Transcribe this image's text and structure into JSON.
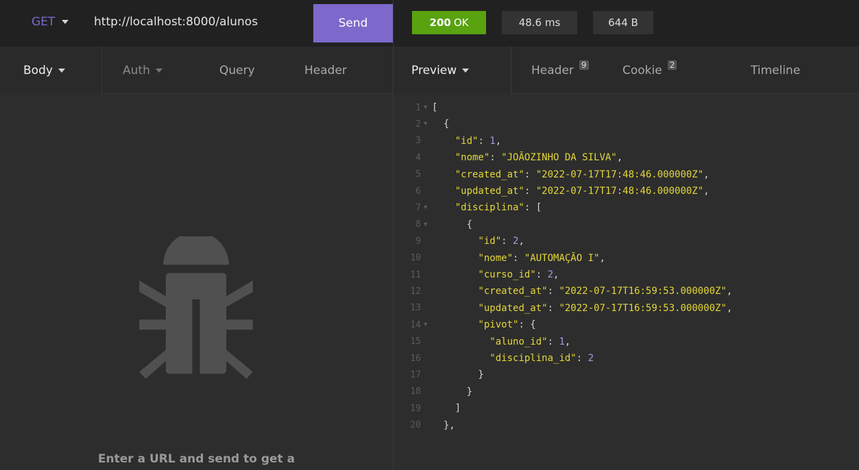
{
  "request": {
    "method": "GET",
    "url": "http://localhost:8000/alunos",
    "send_label": "Send",
    "tabs": [
      {
        "label": "Body"
      },
      {
        "label": "Auth"
      },
      {
        "label": "Query"
      },
      {
        "label": "Header"
      }
    ],
    "empty_hint": "Enter a URL and send to get a"
  },
  "response": {
    "status_code": "200",
    "status_text": "OK",
    "time": "48.6 ms",
    "size": "644 B",
    "tabs": [
      {
        "label": "Preview"
      },
      {
        "label": "Header",
        "badge": "9"
      },
      {
        "label": "Cookie",
        "badge": "2"
      },
      {
        "label": "Timeline"
      }
    ]
  },
  "code_lines": [
    {
      "n": "1",
      "fold": true,
      "html": "<span class=\"txt\">[</span>"
    },
    {
      "n": "2",
      "fold": true,
      "html": "<span class=\"txt\">  {</span>"
    },
    {
      "n": "3",
      "fold": false,
      "html": "    <span class=\"k\">\"id\"</span><span class=\"txt\">: </span><span class=\"n\">1</span><span class=\"txt\">,</span>"
    },
    {
      "n": "4",
      "fold": false,
      "html": "    <span class=\"k\">\"nome\"</span><span class=\"txt\">: </span><span class=\"s\">\"JOÃOZINHO DA SILVA\"</span><span class=\"txt\">,</span>"
    },
    {
      "n": "5",
      "fold": false,
      "html": "    <span class=\"k\">\"created_at\"</span><span class=\"txt\">: </span><span class=\"s\">\"2022-07-17T17:48:46.000000Z\"</span><span class=\"txt\">,</span>"
    },
    {
      "n": "6",
      "fold": false,
      "html": "    <span class=\"k\">\"updated_at\"</span><span class=\"txt\">: </span><span class=\"s\">\"2022-07-17T17:48:46.000000Z\"</span><span class=\"txt\">,</span>"
    },
    {
      "n": "7",
      "fold": true,
      "html": "    <span class=\"k\">\"disciplina\"</span><span class=\"txt\">: [</span>"
    },
    {
      "n": "8",
      "fold": true,
      "html": "<span class=\"txt\">      {</span>"
    },
    {
      "n": "9",
      "fold": false,
      "html": "        <span class=\"k\">\"id\"</span><span class=\"txt\">: </span><span class=\"n\">2</span><span class=\"txt\">,</span>"
    },
    {
      "n": "10",
      "fold": false,
      "html": "        <span class=\"k\">\"nome\"</span><span class=\"txt\">: </span><span class=\"s\">\"AUTOMAÇÃO I\"</span><span class=\"txt\">,</span>"
    },
    {
      "n": "11",
      "fold": false,
      "html": "        <span class=\"k\">\"curso_id\"</span><span class=\"txt\">: </span><span class=\"n\">2</span><span class=\"txt\">,</span>"
    },
    {
      "n": "12",
      "fold": false,
      "html": "        <span class=\"k\">\"created_at\"</span><span class=\"txt\">: </span><span class=\"s\">\"2022-07-17T16:59:53.000000Z\"</span><span class=\"txt\">,</span>"
    },
    {
      "n": "13",
      "fold": false,
      "html": "        <span class=\"k\">\"updated_at\"</span><span class=\"txt\">: </span><span class=\"s\">\"2022-07-17T16:59:53.000000Z\"</span><span class=\"txt\">,</span>"
    },
    {
      "n": "14",
      "fold": true,
      "html": "        <span class=\"k\">\"pivot\"</span><span class=\"txt\">: {</span>"
    },
    {
      "n": "15",
      "fold": false,
      "html": "          <span class=\"k\">\"aluno_id\"</span><span class=\"txt\">: </span><span class=\"n\">1</span><span class=\"txt\">,</span>"
    },
    {
      "n": "16",
      "fold": false,
      "html": "          <span class=\"k\">\"disciplina_id\"</span><span class=\"txt\">: </span><span class=\"n\">2</span>"
    },
    {
      "n": "17",
      "fold": false,
      "html": "<span class=\"txt\">        }</span>"
    },
    {
      "n": "18",
      "fold": false,
      "html": "<span class=\"txt\">      }</span>"
    },
    {
      "n": "19",
      "fold": false,
      "html": "<span class=\"txt\">    ]</span>"
    },
    {
      "n": "20",
      "fold": false,
      "html": "<span class=\"txt\">  },</span>"
    }
  ]
}
